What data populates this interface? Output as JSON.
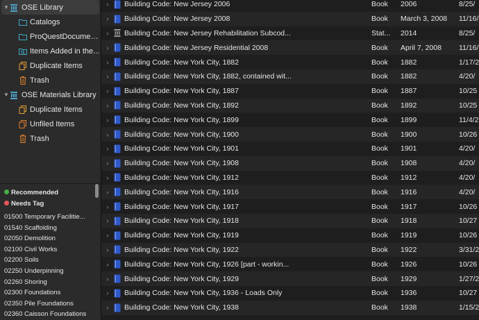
{
  "colors": {
    "recommended": "#43b14b",
    "needs_tag": "#e8565b",
    "library_icon": "#4ea1c7",
    "folder": "#3fa9c9",
    "trash": "#e0822f",
    "duplicate": "#e8a33a",
    "unfiled": "#e0822f",
    "book_icon": "#2f58c8",
    "statute_icon": "#9a9a9a"
  },
  "sidebar": {
    "tree": [
      {
        "label": "OSE Library",
        "icon": "library-icon",
        "level": 0,
        "expanded": true,
        "selected": true
      },
      {
        "label": "Catalogs",
        "icon": "folder-icon",
        "level": 1
      },
      {
        "label": "ProQuestDocumen...",
        "icon": "folder-icon",
        "level": 1
      },
      {
        "label": "Items Added in the...",
        "icon": "saved-search-icon",
        "level": 1
      },
      {
        "label": "Duplicate Items",
        "icon": "duplicate-items-icon",
        "level": 1
      },
      {
        "label": "Trash",
        "icon": "trash-icon",
        "level": 1
      },
      {
        "label": "OSE Materials Library",
        "icon": "library-icon",
        "level": 0,
        "expanded": true
      },
      {
        "label": "Duplicate Items",
        "icon": "duplicate-items-icon",
        "level": 1
      },
      {
        "label": "Unfiled Items",
        "icon": "unfiled-items-icon",
        "level": 1
      },
      {
        "label": "Trash",
        "icon": "trash-icon",
        "level": 1
      }
    ],
    "colored_tags": [
      {
        "label": "Recommended",
        "color": "#43b14b"
      },
      {
        "label": "Needs Tag",
        "color": "#e8565b"
      }
    ],
    "tags": [
      "01500 Temporary Facilitie...",
      "01540 Scaffolding",
      "02050 Demolition",
      "02100 Civil Works",
      "02200 Soils",
      "02250 Underpinning",
      "02260 Shoring",
      "02300 Foundations",
      "02350 Pile Foundations",
      "02360 Caisson Foundations"
    ]
  },
  "items": [
    {
      "title": "Building Code: New Jersey 2006",
      "type": "Book",
      "date": "2006",
      "added": "8/25/",
      "icon": "book-icon"
    },
    {
      "title": "Building Code: New Jersey 2008",
      "type": "Book",
      "date": "March 3, 2008",
      "added": "11/16/",
      "icon": "book-icon"
    },
    {
      "title": "Building Code: New Jersey Rehabilitation Subcod...",
      "type": "Stat...",
      "date": "2014",
      "added": "8/25/",
      "icon": "statute-icon"
    },
    {
      "title": "Building Code: New Jersey Residential 2008",
      "type": "Book",
      "date": "April 7, 2008",
      "added": "11/16/",
      "icon": "book-icon"
    },
    {
      "title": "Building Code: New York City, 1882",
      "type": "Book",
      "date": "1882",
      "added": "1/17/2",
      "icon": "book-icon"
    },
    {
      "title": "Building Code: New York City, 1882, contained wit...",
      "type": "Book",
      "date": "1882",
      "added": "4/20/",
      "icon": "book-icon"
    },
    {
      "title": "Building Code: New York City, 1887",
      "type": "Book",
      "date": "1887",
      "added": "10/25",
      "icon": "book-icon"
    },
    {
      "title": "Building Code: New York City, 1892",
      "type": "Book",
      "date": "1892",
      "added": "10/25",
      "icon": "book-icon"
    },
    {
      "title": "Building Code: New York City, 1899",
      "type": "Book",
      "date": "1899",
      "added": "11/4/2",
      "icon": "book-icon"
    },
    {
      "title": "Building Code: New York City, 1900",
      "type": "Book",
      "date": "1900",
      "added": "10/26",
      "icon": "book-icon"
    },
    {
      "title": "Building Code: New York City, 1901",
      "type": "Book",
      "date": "1901",
      "added": "4/20/",
      "icon": "book-icon"
    },
    {
      "title": "Building Code: New York City, 1908",
      "type": "Book",
      "date": "1908",
      "added": "4/20/",
      "icon": "book-icon"
    },
    {
      "title": "Building Code: New York City, 1912",
      "type": "Book",
      "date": "1912",
      "added": "4/20/",
      "icon": "book-icon"
    },
    {
      "title": "Building Code: New York City, 1916",
      "type": "Book",
      "date": "1916",
      "added": "4/20/",
      "icon": "book-icon"
    },
    {
      "title": "Building Code: New York City, 1917",
      "type": "Book",
      "date": "1917",
      "added": "10/26",
      "icon": "book-icon"
    },
    {
      "title": "Building Code: New York City, 1918",
      "type": "Book",
      "date": "1918",
      "added": "10/27",
      "icon": "book-icon"
    },
    {
      "title": "Building Code: New York City, 1919",
      "type": "Book",
      "date": "1919",
      "added": "10/26",
      "icon": "book-icon"
    },
    {
      "title": "Building Code: New York City, 1922",
      "type": "Book",
      "date": "1922",
      "added": "3/31/2",
      "icon": "book-icon"
    },
    {
      "title": "Building Code: New York City, 1926 [part - workin...",
      "type": "Book",
      "date": "1926",
      "added": "10/26",
      "icon": "book-icon"
    },
    {
      "title": "Building Code: New York City, 1929",
      "type": "Book",
      "date": "1929",
      "added": "1/27/2",
      "icon": "book-icon"
    },
    {
      "title": "Building Code: New York City, 1936 - Loads Only",
      "type": "Book",
      "date": "1936",
      "added": "10/27",
      "icon": "book-icon"
    },
    {
      "title": "Building Code: New York City, 1938",
      "type": "Book",
      "date": "1938",
      "added": "1/15/2",
      "icon": "book-icon"
    }
  ]
}
